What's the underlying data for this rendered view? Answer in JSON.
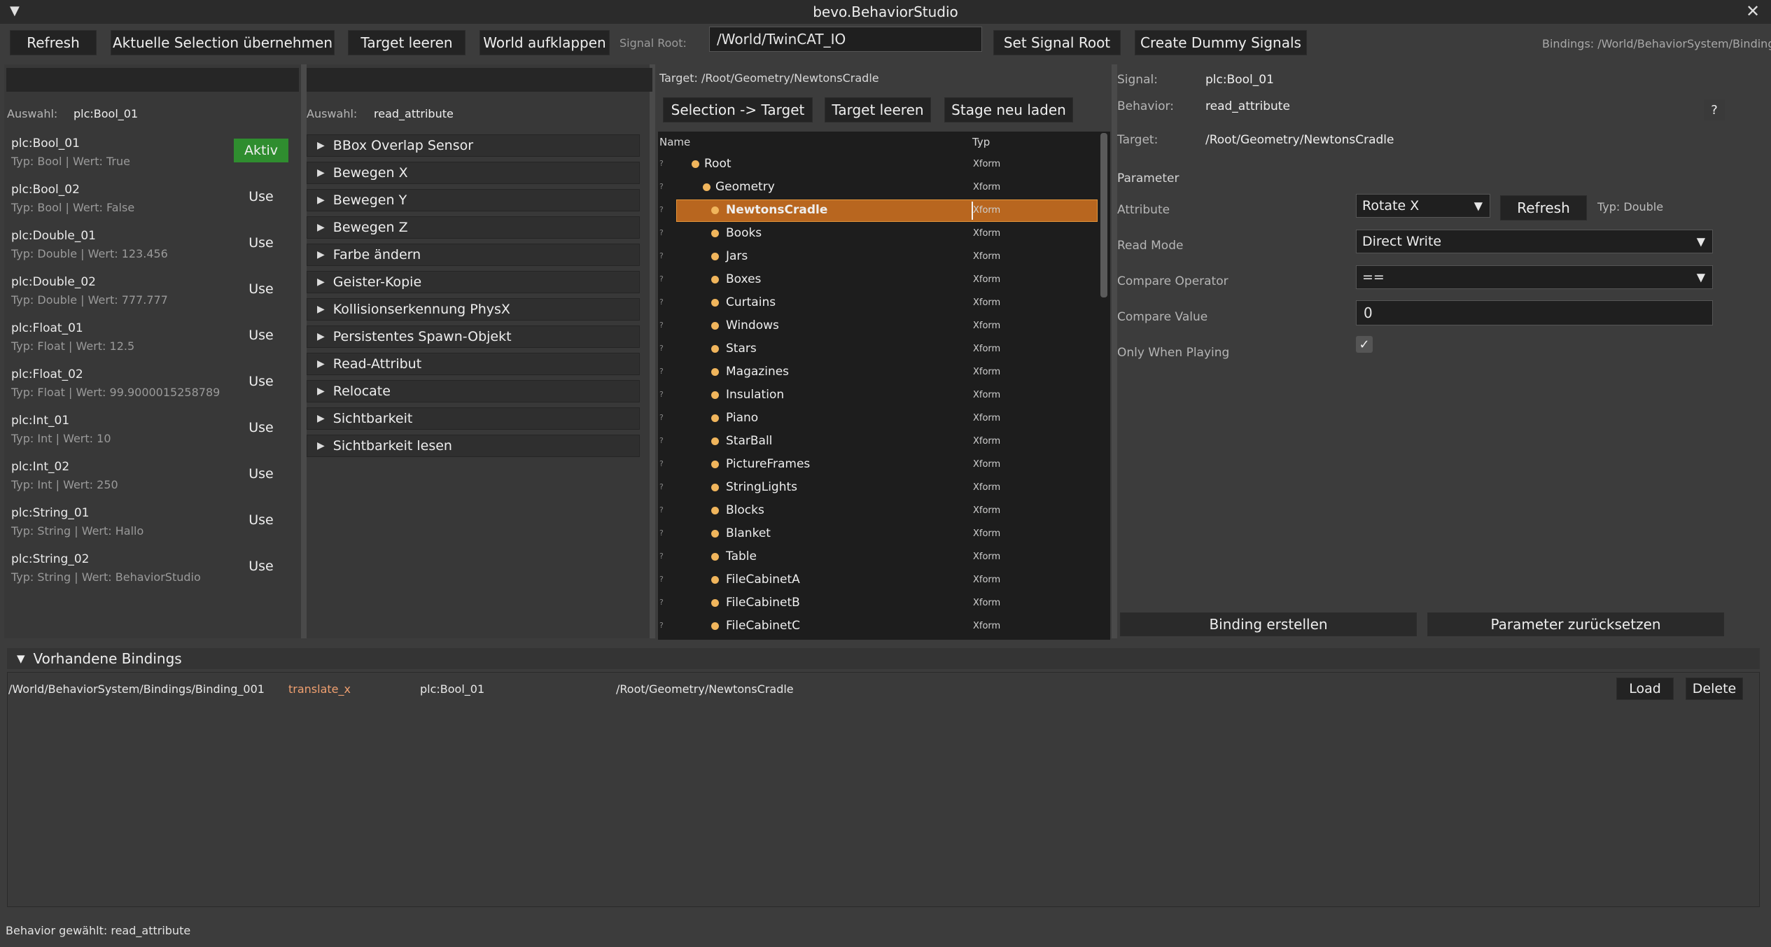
{
  "window": {
    "title": "bevo.BehaviorStudio",
    "menu_icon": "triangle-down-icon",
    "close_icon": "close-icon"
  },
  "toolbar": {
    "refresh": "Refresh",
    "take_selection": "Aktuelle Selection übernehmen",
    "clear_target": "Target leeren",
    "expand_world": "World aufklappen",
    "signal_root_label": "Signal Root:",
    "signal_root_value": "/World/TwinCAT_IO",
    "set_signal_root": "Set Signal Root",
    "create_dummy": "Create Dummy Signals",
    "bindings_path": "Bindings: /World/BehaviorSystem/Bindings"
  },
  "signals": {
    "filter": "",
    "selection_label": "Auswahl:",
    "selection_value": "plc:Bool_01",
    "items": [
      {
        "name": "plc:Bool_01",
        "info": "Typ: Bool | Wert: True",
        "action": "Aktiv",
        "active": true
      },
      {
        "name": "plc:Bool_02",
        "info": "Typ: Bool | Wert: False",
        "action": "Use",
        "active": false
      },
      {
        "name": "plc:Double_01",
        "info": "Typ: Double | Wert: 123.456",
        "action": "Use",
        "active": false
      },
      {
        "name": "plc:Double_02",
        "info": "Typ: Double | Wert: 777.777",
        "action": "Use",
        "active": false
      },
      {
        "name": "plc:Float_01",
        "info": "Typ: Float | Wert: 12.5",
        "action": "Use",
        "active": false
      },
      {
        "name": "plc:Float_02",
        "info": "Typ: Float | Wert: 99.9000015258789",
        "action": "Use",
        "active": false
      },
      {
        "name": "plc:Int_01",
        "info": "Typ: Int | Wert: 10",
        "action": "Use",
        "active": false
      },
      {
        "name": "plc:Int_02",
        "info": "Typ: Int | Wert: 250",
        "action": "Use",
        "active": false
      },
      {
        "name": "plc:String_01",
        "info": "Typ: String | Wert: Hallo",
        "action": "Use",
        "active": false
      },
      {
        "name": "plc:String_02",
        "info": "Typ: String | Wert: BehaviorStudio",
        "action": "Use",
        "active": false
      }
    ]
  },
  "behaviors": {
    "filter": "",
    "selection_label": "Auswahl:",
    "selection_value": "read_attribute",
    "items": [
      "BBox Overlap Sensor",
      "Bewegen X",
      "Bewegen Y",
      "Bewegen Z",
      "Farbe ändern",
      "Geister-Kopie",
      "Kollisionserkennung PhysX",
      "Persistentes Spawn-Objekt",
      "Read-Attribut",
      "Relocate",
      "Sichtbarkeit",
      "Sichtbarkeit lesen"
    ]
  },
  "stage": {
    "target_label": "Target: /Root/Geometry/NewtonsCradle",
    "selection_to_target": "Selection -> Target",
    "clear_target": "Target leeren",
    "reload_stage": "Stage neu laden",
    "col_name": "Name",
    "col_type": "Typ",
    "rows": [
      {
        "name": "Root",
        "type": "Xform",
        "depth": 0,
        "selected": false
      },
      {
        "name": "Geometry",
        "type": "Xform",
        "depth": 1,
        "selected": false
      },
      {
        "name": "NewtonsCradle",
        "type": "Xform",
        "depth": 2,
        "selected": true
      },
      {
        "name": "Books",
        "type": "Xform",
        "depth": 2,
        "selected": false
      },
      {
        "name": "Jars",
        "type": "Xform",
        "depth": 2,
        "selected": false
      },
      {
        "name": "Boxes",
        "type": "Xform",
        "depth": 2,
        "selected": false
      },
      {
        "name": "Curtains",
        "type": "Xform",
        "depth": 2,
        "selected": false
      },
      {
        "name": "Windows",
        "type": "Xform",
        "depth": 2,
        "selected": false
      },
      {
        "name": "Stars",
        "type": "Xform",
        "depth": 2,
        "selected": false
      },
      {
        "name": "Magazines",
        "type": "Xform",
        "depth": 2,
        "selected": false
      },
      {
        "name": "Insulation",
        "type": "Xform",
        "depth": 2,
        "selected": false
      },
      {
        "name": "Piano",
        "type": "Xform",
        "depth": 2,
        "selected": false
      },
      {
        "name": "StarBall",
        "type": "Xform",
        "depth": 2,
        "selected": false
      },
      {
        "name": "PictureFrames",
        "type": "Xform",
        "depth": 2,
        "selected": false
      },
      {
        "name": "StringLights",
        "type": "Xform",
        "depth": 2,
        "selected": false
      },
      {
        "name": "Blocks",
        "type": "Xform",
        "depth": 2,
        "selected": false
      },
      {
        "name": "Blanket",
        "type": "Xform",
        "depth": 2,
        "selected": false
      },
      {
        "name": "Table",
        "type": "Xform",
        "depth": 2,
        "selected": false
      },
      {
        "name": "FileCabinetA",
        "type": "Xform",
        "depth": 2,
        "selected": false
      },
      {
        "name": "FileCabinetB",
        "type": "Xform",
        "depth": 2,
        "selected": false
      },
      {
        "name": "FileCabinetC",
        "type": "Xform",
        "depth": 2,
        "selected": false
      }
    ]
  },
  "details": {
    "signal_label": "Signal:",
    "signal_value": "plc:Bool_01",
    "behavior_label": "Behavior:",
    "behavior_value": "read_attribute",
    "help": "?",
    "target_label": "Target:",
    "target_value": "/Root/Geometry/NewtonsCradle",
    "parameter_heading": "Parameter",
    "attribute_label": "Attribute",
    "attribute_value": "Rotate X",
    "refresh": "Refresh",
    "attr_type": "Typ: Double",
    "read_mode_label": "Read Mode",
    "read_mode_value": "Direct Write",
    "compare_op_label": "Compare Operator",
    "compare_op_value": "==",
    "compare_val_label": "Compare Value",
    "compare_val_value": "0",
    "only_playing_label": "Only When Playing",
    "only_playing_checked": "✓",
    "create_binding": "Binding erstellen",
    "reset_params": "Parameter zurücksetzen"
  },
  "bindings": {
    "header": "Vorhandene Bindings",
    "rows": [
      {
        "path": "/World/BehaviorSystem/Bindings/Binding_001",
        "behavior": "translate_x",
        "signal": "plc:Bool_01",
        "target": "/Root/Geometry/NewtonsCradle",
        "load": "Load",
        "delete": "Delete"
      }
    ]
  },
  "status": {
    "text": "Behavior gewählt: read_attribute"
  },
  "colors": {
    "accent_orange": "#b8661f",
    "active_green": "#2f8d2f",
    "binding_behavior": "#f0a070",
    "dot": "#f0b55c"
  }
}
